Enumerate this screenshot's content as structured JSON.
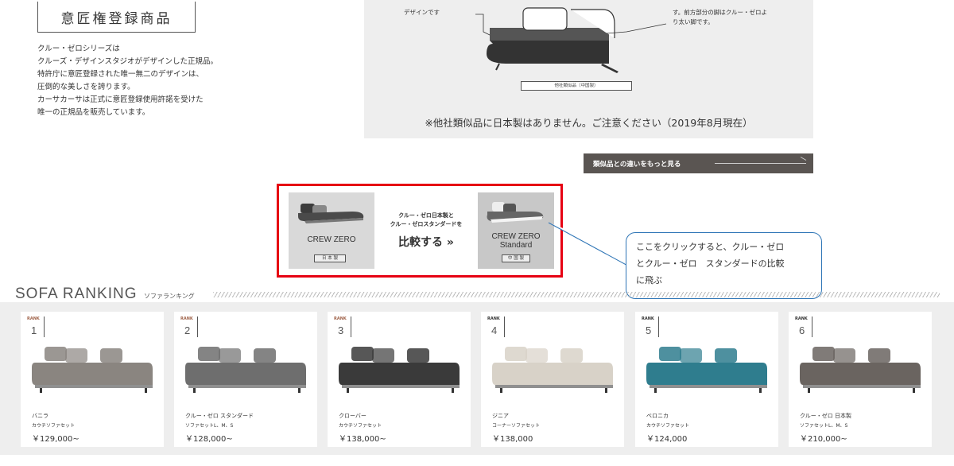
{
  "design": {
    "title": "意匠権登録商品",
    "lines": [
      "クルー・ゼロシリーズは",
      "クルーズ・デザインスタジオがデザインした正規品。",
      "特許庁に意匠登録された唯一無二のデザインは、",
      "圧倒的な美しさを誇ります。",
      "カーサカーサは正式に意匠登録使用許諾を受けた",
      "唯一の正規品を販売しています。"
    ]
  },
  "illustration": {
    "note_left": "デザインです",
    "note_right_1": "す。前方部分の脚はクルー・ゼロよ",
    "note_right_2": "り太い脚です。",
    "caption": "他社類似品（中国製）",
    "warning": "※他社類似品に日本製はありません。ご注意ください（2019年8月現在）"
  },
  "more_button": {
    "label": "類似品との違いをもっと見る"
  },
  "compare": {
    "left_name": "CREW ZERO",
    "left_tag": "日 本 製",
    "mid_line1": "クルー・ゼロ日本製と",
    "mid_line2": "クルー・ゼロスタンダードを",
    "mid_line3": "比較する »",
    "right_name_1": "CREW ZERO",
    "right_name_2": "Standard",
    "right_tag": "中 国 製"
  },
  "callout": {
    "line1": "ここをクリックすると、クルー・ゼロ",
    "line2": "とクルー・ゼロ　スタンダードの比較",
    "line3": "に飛ぶ"
  },
  "ranking": {
    "title": "SOFA RANKING",
    "subtitle": "ソファランキング",
    "rank_label": "RANK",
    "items": [
      {
        "rank": "1",
        "name": "バニラ",
        "type": "カウチソファセット",
        "price": "￥129,000~",
        "color": "#8a8580"
      },
      {
        "rank": "2",
        "name": "クルー・ゼロ スタンダード",
        "type": "ソファセットL、M、S",
        "price": "￥128,000~",
        "color": "#6e6e6e"
      },
      {
        "rank": "3",
        "name": "クローバー",
        "type": "カウチソファセット",
        "price": "￥138,000~",
        "color": "#3a3a3a"
      },
      {
        "rank": "4",
        "name": "ジニア",
        "type": "コーナーソファセット",
        "price": "￥138,000",
        "color": "#d8d2c8"
      },
      {
        "rank": "5",
        "name": "ベロニカ",
        "type": "カウチソファセット",
        "price": "￥124,000",
        "color": "#2f7d8e"
      },
      {
        "rank": "6",
        "name": "クルー・ゼロ 日本製",
        "type": "ソファセットL、M、S",
        "price": "￥210,000~",
        "color": "#6a6460"
      }
    ]
  }
}
